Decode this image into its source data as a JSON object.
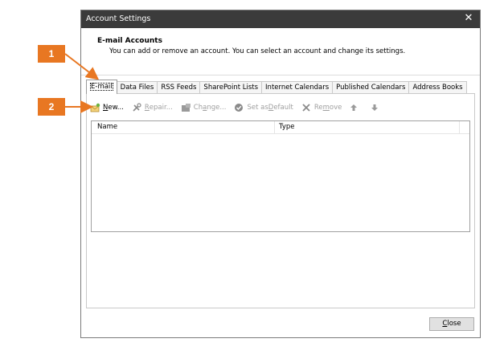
{
  "window": {
    "title": "Account Settings",
    "close_glyph": "✕"
  },
  "header": {
    "title": "E-mail Accounts",
    "description": "You can add or remove an account. You can select an account and change its settings."
  },
  "tabs": [
    {
      "label": "E-mail",
      "active": true
    },
    {
      "label": "Data Files"
    },
    {
      "label": "RSS Feeds"
    },
    {
      "label": "SharePoint Lists"
    },
    {
      "label": "Internet Calendars"
    },
    {
      "label": "Published Calendars"
    },
    {
      "label": "Address Books"
    }
  ],
  "toolbar": {
    "new_pre": "",
    "new_ul": "N",
    "new_post": "ew...",
    "repair_pre": "",
    "repair_ul": "R",
    "repair_post": "epair...",
    "change_pre": "Ch",
    "change_ul": "a",
    "change_post": "nge...",
    "default_pre": "Set as ",
    "default_ul": "D",
    "default_post": "efault",
    "remove_pre": "Re",
    "remove_ul": "m",
    "remove_post": "ove"
  },
  "list": {
    "col_name": "Name",
    "col_type": "Type"
  },
  "footer": {
    "close_ul": "C",
    "close_post": "lose"
  },
  "callouts": {
    "one": "1",
    "two": "2"
  },
  "colors": {
    "callout": "#e87722",
    "titlebar": "#3b3b3b"
  }
}
